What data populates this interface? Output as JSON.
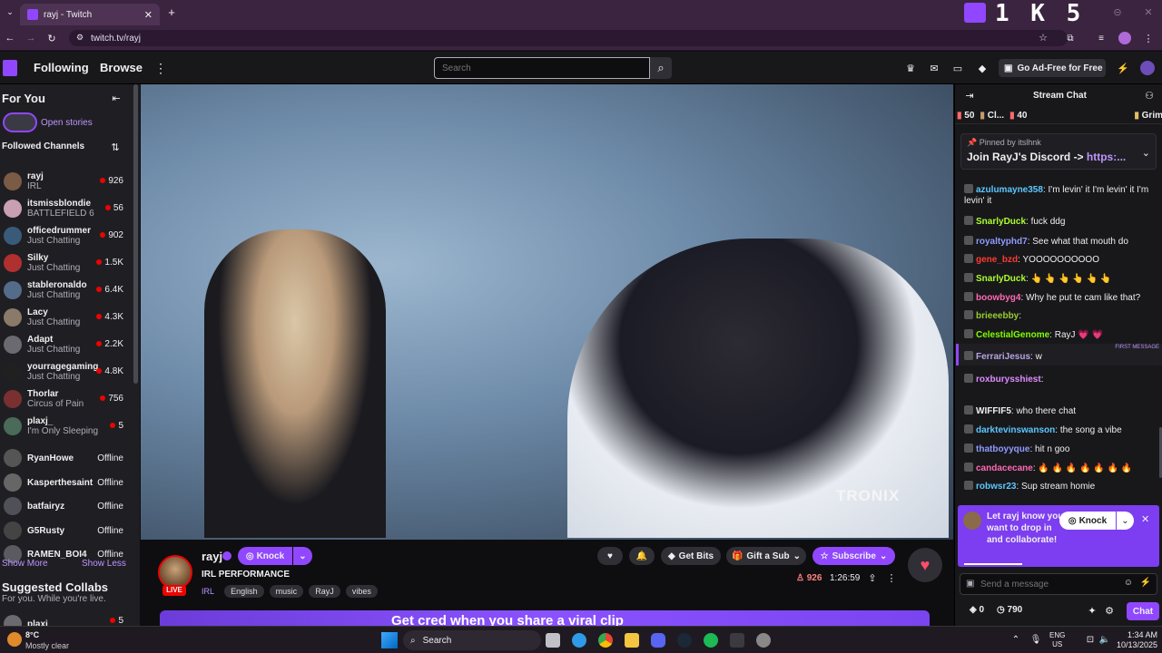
{
  "browser": {
    "tab_title": "rayj - Twitch",
    "url": "twitch.tv/rayj",
    "counter": "1 K 5"
  },
  "nav": {
    "following": "Following",
    "browse": "Browse",
    "search_placeholder": "Search",
    "ad_free": "Go Ad-Free for Free"
  },
  "sidebar": {
    "for_you": "For You",
    "open_stories": "Open stories",
    "followed_channels": "Followed Channels",
    "channels": [
      {
        "name": "rayj",
        "game": "IRL",
        "viewers": "926"
      },
      {
        "name": "itsmissblondie",
        "game": "BATTLEFIELD 6",
        "viewers": "56"
      },
      {
        "name": "officedrummer",
        "game": "Just Chatting",
        "viewers": "902"
      },
      {
        "name": "Silky",
        "game": "Just Chatting",
        "viewers": "1.5K"
      },
      {
        "name": "stableronaldo",
        "game": "Just Chatting",
        "viewers": "6.4K"
      },
      {
        "name": "Lacy",
        "game": "Just Chatting",
        "viewers": "4.3K"
      },
      {
        "name": "Adapt",
        "game": "Just Chatting",
        "viewers": "2.2K"
      },
      {
        "name": "yourragegaming",
        "game": "Just Chatting",
        "viewers": "4.8K"
      },
      {
        "name": "Thorlar",
        "game": "Circus of Pain",
        "viewers": "756"
      },
      {
        "name": "plaxj_",
        "game": "I'm Only Sleeping",
        "viewers": "5"
      },
      {
        "name": "RyanHowe",
        "game": "",
        "viewers": "Offline"
      },
      {
        "name": "Kasperthesaint",
        "game": "",
        "viewers": "Offline"
      },
      {
        "name": "batfairyz",
        "game": "",
        "viewers": "Offline"
      },
      {
        "name": "G5Rusty",
        "game": "",
        "viewers": "Offline"
      },
      {
        "name": "RAMEN_BOI4",
        "game": "",
        "viewers": "Offline"
      }
    ],
    "show_more": "Show More",
    "show_less": "Show Less",
    "suggested_title": "Suggested Collabs",
    "suggested_sub": "For you. While you're live.",
    "suggested_name": "plaxj_",
    "suggested_viewers": "5"
  },
  "video": {
    "watermark": "TRONIX"
  },
  "streamer": {
    "name": "rayj",
    "knock": "Knock",
    "title": "IRL PERFORMANCE",
    "live": "LIVE",
    "tags": [
      "IRL",
      "English",
      "music",
      "RayJ",
      "vibes"
    ],
    "viewers": "926",
    "uptime": "1:26:59",
    "get_bits": "Get Bits",
    "gift_sub": "Gift a Sub",
    "subscribe": "Subscribe",
    "banner": "Get cred when you share a viral clip"
  },
  "chat": {
    "title": "Stream Chat",
    "stat1": "50",
    "stat2": "Cl...",
    "stat3": "40",
    "stat4": "Grim",
    "pinned_by": "Pinned by",
    "pinned_user": "itslhnk",
    "pinned_text": "Join RayJ's Discord -> ",
    "pinned_link": "https:...",
    "messages": [
      {
        "user": "azulumayne358",
        "color": "#5cc8ff",
        "text": "I'm levin' it  I'm levin' it  I'm levin' it"
      },
      {
        "user": "SnarlyDuck",
        "color": "#adff2f",
        "text": "fuck ddg"
      },
      {
        "user": "royaltyphd7",
        "color": "#8f9bff",
        "text": "See what that mouth do"
      },
      {
        "user": "gene_bzd",
        "color": "#ff3b30",
        "text": "YOOOOOOOOOO"
      },
      {
        "user": "SnarlyDuck",
        "color": "#adff2f",
        "text": "👆 👆 👆 👆 👆 👆"
      },
      {
        "user": "boowbyg4",
        "color": "#ff69b4",
        "text": "Why he put te cam like that?"
      },
      {
        "user": "brieeebby",
        "color": "#9acd32",
        "text": ""
      },
      {
        "user": "CelestialGenome",
        "color": "#7fff00",
        "text": "RayJ 💗 💗"
      },
      {
        "user": "FerrariJesus",
        "color": "#b9a3e3",
        "text": "w"
      },
      {
        "user": "roxburysshiest",
        "color": "#e08cff",
        "text": ""
      },
      {
        "user": "WIFFIF5",
        "color": "#efeff1",
        "text": "who there chat"
      },
      {
        "user": "darktevinswanson",
        "color": "#5cc8ff",
        "text": "the song a vibe"
      },
      {
        "user": "thatboyyque",
        "color": "#8f9bff",
        "text": "hit n goo"
      },
      {
        "user": "candacecane",
        "color": "#ff69b4",
        "text": "🔥 🔥 🔥 🔥 🔥 🔥 🔥"
      },
      {
        "user": "robwsr23",
        "color": "#5cc8ff",
        "text": "Sup stream homie"
      }
    ],
    "first_message": "FIRST MESSAGE",
    "collab_text": "Let rayj know you want to drop in and collaborate!",
    "collab_knock": "Knock",
    "send_placeholder": "Send a message",
    "points": "0",
    "bits": "790",
    "chat_btn": "Chat"
  },
  "taskbar": {
    "temp": "8°C",
    "weather": "Mostly clear",
    "search": "Search",
    "lang1": "ENG",
    "lang2": "US",
    "time": "1:34 AM",
    "date": "10/13/2025"
  },
  "colors": {
    "twitch_purple": "#9147ff",
    "live_red": "#eb0400"
  }
}
